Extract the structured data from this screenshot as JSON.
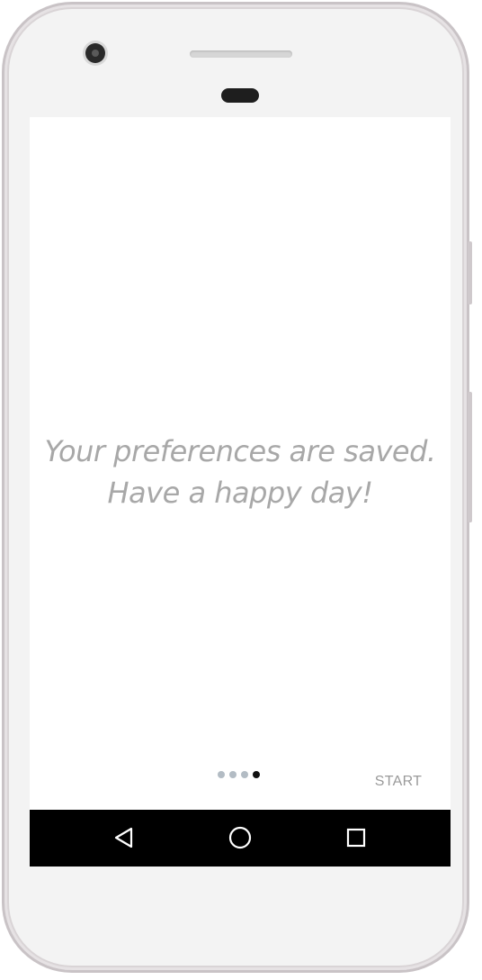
{
  "screen": {
    "message_line1": "Your preferences are saved.",
    "message_line2": "Have a happy day!",
    "start_label": "START"
  },
  "pager": {
    "total_pages": 4,
    "active_page": 4
  },
  "navbar": {
    "back_icon": "triangle-back-icon",
    "home_icon": "circle-home-icon",
    "recents_icon": "square-recents-icon"
  },
  "colors": {
    "message_text": "#a8a8a8",
    "dot_inactive": "#b3bcc4",
    "dot_active": "#111111",
    "start_text": "#9a9a9a",
    "navbar_bg": "#000000"
  }
}
